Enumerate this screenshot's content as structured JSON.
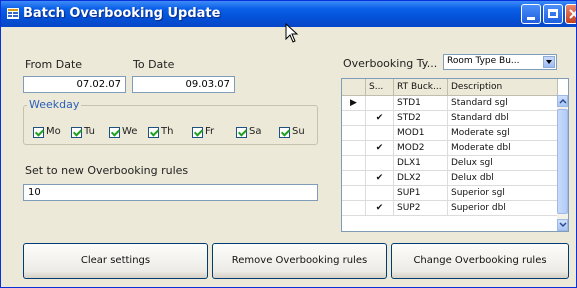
{
  "window": {
    "title": "Batch Overbooking Update"
  },
  "dates": {
    "from_label": "From Date",
    "to_label": "To Date",
    "from_value": "07.02.07",
    "to_value": "09.03.07"
  },
  "weekday": {
    "group_label": "Weekday",
    "days": [
      {
        "label": "Mo",
        "checked": true
      },
      {
        "label": "Tu",
        "checked": true
      },
      {
        "label": "We",
        "checked": true
      },
      {
        "label": "Th",
        "checked": true
      },
      {
        "label": "Fr",
        "checked": true
      },
      {
        "label": "Sa",
        "checked": true
      },
      {
        "label": "Su",
        "checked": true
      }
    ]
  },
  "rules": {
    "label": "Set to new Overbooking rules",
    "value": "10"
  },
  "overbooking_type": {
    "label": "Overbooking Ty...",
    "value": "Room Type Bu..."
  },
  "grid": {
    "headers": [
      "S...",
      "RT Buck...",
      "Description"
    ],
    "rows": [
      {
        "selected": false,
        "code": "STD1",
        "desc": "Standard sgl"
      },
      {
        "selected": true,
        "code": "STD2",
        "desc": "Standard dbl"
      },
      {
        "selected": false,
        "code": "MOD1",
        "desc": "Moderate sgl"
      },
      {
        "selected": true,
        "code": "MOD2",
        "desc": "Moderate dbl"
      },
      {
        "selected": false,
        "code": "DLX1",
        "desc": "Delux sgl"
      },
      {
        "selected": true,
        "code": "DLX2",
        "desc": "Delux dbl"
      },
      {
        "selected": false,
        "code": "SUP1",
        "desc": "Superior sgl"
      },
      {
        "selected": true,
        "code": "SUP2",
        "desc": "Superior dbl"
      }
    ],
    "check_mark": "✔",
    "row_pointer": "▶"
  },
  "buttons": {
    "clear": "Clear settings",
    "remove": "Remove Overbooking rules",
    "change": "Change Overbooking rules"
  },
  "colors": {
    "title_bar": "#0453d9",
    "window_bg": "#ECE9D8"
  }
}
